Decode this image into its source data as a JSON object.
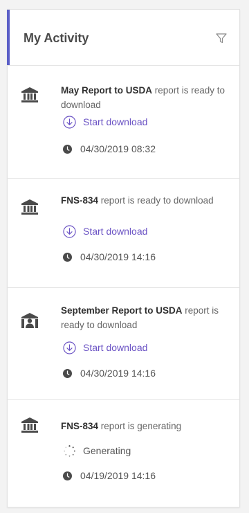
{
  "panel": {
    "title": "My Activity",
    "filter_icon": "filter-icon"
  },
  "colors": {
    "accent": "#5b5fc7",
    "link": "#6a52c4",
    "icon": "#4a4a4a"
  },
  "items": [
    {
      "icon": "bank-icon",
      "bold": "May Report to USDA",
      "rest": " report is ready to download",
      "action": "Start download",
      "action_icon": "download-circle-icon",
      "timestamp": "04/30/2019 08:32"
    },
    {
      "icon": "bank-icon",
      "bold": "FNS-834",
      "rest": " report is ready to download",
      "action": "Start download",
      "action_icon": "download-circle-icon",
      "timestamp": "04/30/2019 14:16"
    },
    {
      "icon": "bank-user-icon",
      "bold": "September Report to USDA",
      "rest": " report is ready to download",
      "action": "Start download",
      "action_icon": "download-circle-icon",
      "timestamp": "04/30/2019 14:16"
    },
    {
      "icon": "bank-icon",
      "bold": "FNS-834",
      "rest": " report is generating",
      "action": "Generating",
      "action_icon": "spinner-icon",
      "timestamp": "04/19/2019 14:16"
    }
  ]
}
